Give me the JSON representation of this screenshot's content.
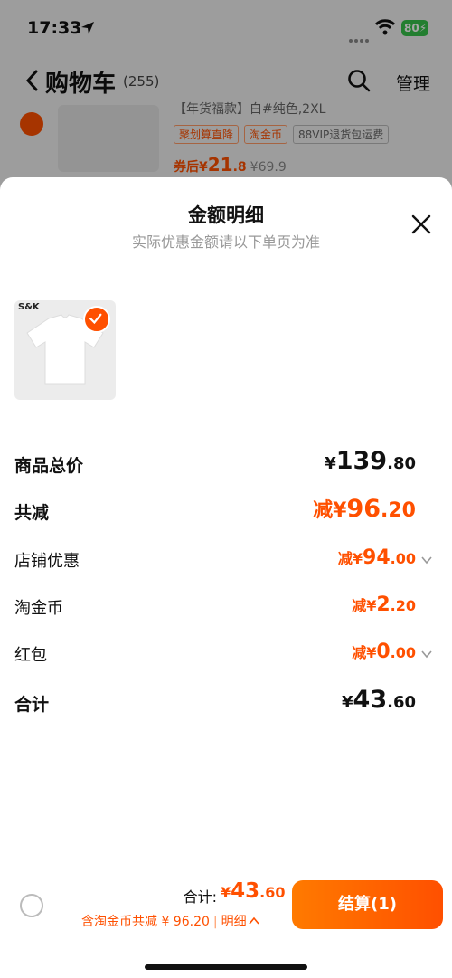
{
  "status_bar": {
    "time": "17:33",
    "battery": "80"
  },
  "nav": {
    "title": "购物车",
    "count": "(255)",
    "manage": "管理"
  },
  "background_item": {
    "spec": "【年货福款】白#纯色,2XL",
    "tags": [
      "聚划算直降",
      "淘金币",
      "88VIP退货包运费"
    ],
    "price_prefix": "券后¥",
    "price_int": "21",
    "price_dec": ".8",
    "orig_price": "¥69.9"
  },
  "sheet": {
    "title": "金额明细",
    "subtitle": "实际优惠金额请以下单页为准",
    "product_brand": "S&K"
  },
  "rows": [
    {
      "label": "商品总价",
      "prefix": "¥",
      "int": "139",
      "dec": ".80"
    },
    {
      "label": "共减",
      "prefix": "减¥",
      "int": "96",
      "dec": ".20"
    },
    {
      "label": "店铺优惠",
      "prefix": "减¥",
      "int": "94",
      "dec": ".00"
    },
    {
      "label": "淘金币",
      "prefix": "减¥",
      "int": "2",
      "dec": ".20"
    },
    {
      "label": "红包",
      "prefix": "减¥",
      "int": "0",
      "dec": ".00"
    },
    {
      "label": "合计",
      "prefix": "¥",
      "int": "43",
      "dec": ".60"
    }
  ],
  "footer": {
    "total_label": "合计:",
    "total_prefix": "¥",
    "total_int": "43",
    "total_dec": ".60",
    "discount_text": "含淘金币共减 ¥ 96.20",
    "detail_label": "明细",
    "pay_button": "结算(1)"
  },
  "colors": {
    "accent": "#ff5000",
    "text": "#111111",
    "muted": "#999999"
  }
}
